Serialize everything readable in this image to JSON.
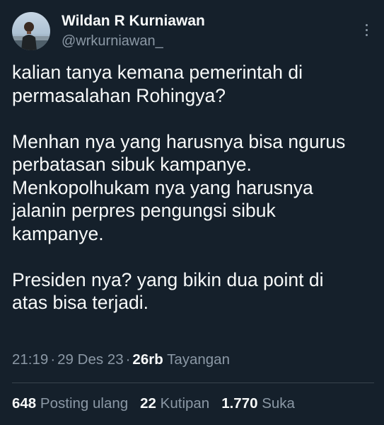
{
  "author": {
    "display_name": "Wildan R Kurniawan",
    "handle": "@wrkurniawan_"
  },
  "tweet": {
    "paragraphs": [
      [
        "kalian tanya kemana pemerintah di",
        "permasalahan Rohingya?"
      ],
      [
        "Menhan nya yang harusnya bisa ngurus",
        "perbatasan sibuk kampanye.",
        "Menkopolhukam nya yang harusnya",
        "jalanin perpres pengungsi sibuk",
        "kampanye."
      ],
      [
        "Presiden nya? yang bikin dua point di",
        "atas bisa terjadi."
      ]
    ]
  },
  "meta": {
    "time": "21:19",
    "date": "29 Des 23",
    "views_count": "26rb",
    "views_label": "Tayangan"
  },
  "stats": {
    "reposts_count": "648",
    "reposts_label": "Posting ulang",
    "quotes_count": "22",
    "quotes_label": "Kutipan",
    "likes_count": "1.770",
    "likes_label": "Suka"
  },
  "colors": {
    "background": "#15202b",
    "text_primary": "#f7f9f9",
    "text_secondary": "#8b98a5",
    "divider": "#38444d"
  },
  "icons": {
    "more": "more-vertical-icon"
  }
}
